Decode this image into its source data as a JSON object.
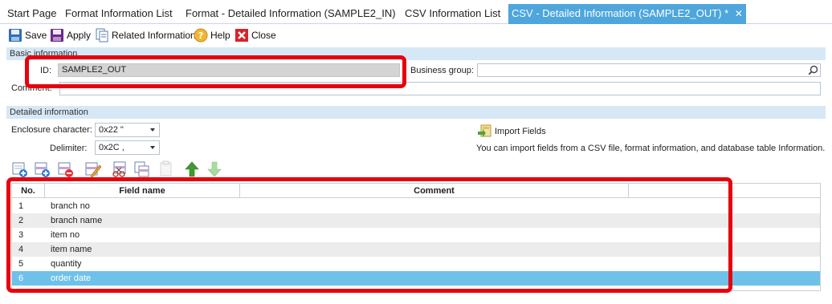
{
  "tabs": [
    {
      "label": "Start Page"
    },
    {
      "label": "Format Information List"
    },
    {
      "label": "Format - Detailed Information (SAMPLE2_IN)"
    },
    {
      "label": "CSV Information List"
    },
    {
      "label": "CSV - Detailed Information (SAMPLE2_OUT) *",
      "close": "✕"
    }
  ],
  "toolbar": {
    "save": "Save",
    "apply": "Apply",
    "related": "Related Information",
    "help": "Help",
    "close": "Close"
  },
  "basic": {
    "header": "Basic information",
    "id_label": "ID:",
    "id_value": "SAMPLE2_OUT",
    "business_group_label": "Business group:",
    "business_group_value": "",
    "comment_label": "Comment:",
    "comment_value": ""
  },
  "detailed": {
    "header": "Detailed information",
    "enclosure_label": "Enclosure character:",
    "enclosure_value": "0x22 \"",
    "delimiter_label": "Delimiter:",
    "delimiter_value": "0x2C ,",
    "import_label": "Import Fields",
    "import_desc": "You can import fields from a CSV file, format information, and database table Information."
  },
  "table": {
    "headers": {
      "no": "No.",
      "field_name": "Field name",
      "comment": "Comment"
    },
    "rows": [
      {
        "no": "1",
        "name": "branch no"
      },
      {
        "no": "2",
        "name": "branch name"
      },
      {
        "no": "3",
        "name": "item no"
      },
      {
        "no": "4",
        "name": "item name"
      },
      {
        "no": "5",
        "name": "quantity"
      },
      {
        "no": "6",
        "name": "order date"
      }
    ],
    "selected_row": 6
  },
  "colors": {
    "active_tab": "#4ea6dc",
    "highlight_box": "#e8000d",
    "selected_row": "#6ec2ea"
  }
}
